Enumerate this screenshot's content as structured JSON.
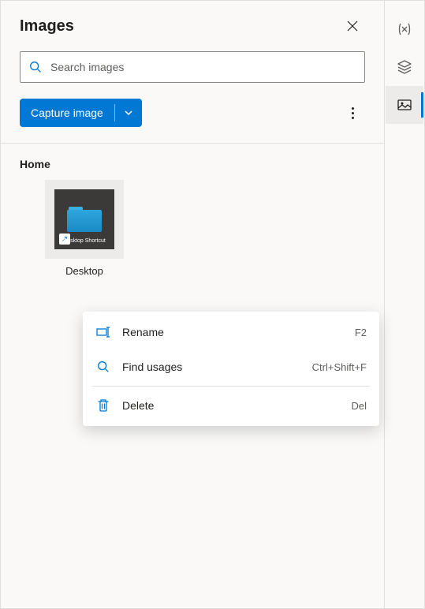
{
  "header": {
    "title": "Images"
  },
  "search": {
    "placeholder": "Search images",
    "value": ""
  },
  "toolbar": {
    "capture_label": "Capture image"
  },
  "section": {
    "label": "Home"
  },
  "items": [
    {
      "label": "Desktop",
      "thumb_caption": "Desktop Shortcut"
    }
  ],
  "contextMenu": {
    "items": [
      {
        "label": "Rename",
        "shortcut": "F2",
        "icon": "rename"
      },
      {
        "label": "Find usages",
        "shortcut": "Ctrl+Shift+F",
        "icon": "search"
      },
      {
        "label": "Delete",
        "shortcut": "Del",
        "icon": "trash"
      }
    ]
  },
  "rail": {
    "items": [
      {
        "name": "variables",
        "active": false
      },
      {
        "name": "layers",
        "active": false
      },
      {
        "name": "images",
        "active": true
      }
    ]
  }
}
